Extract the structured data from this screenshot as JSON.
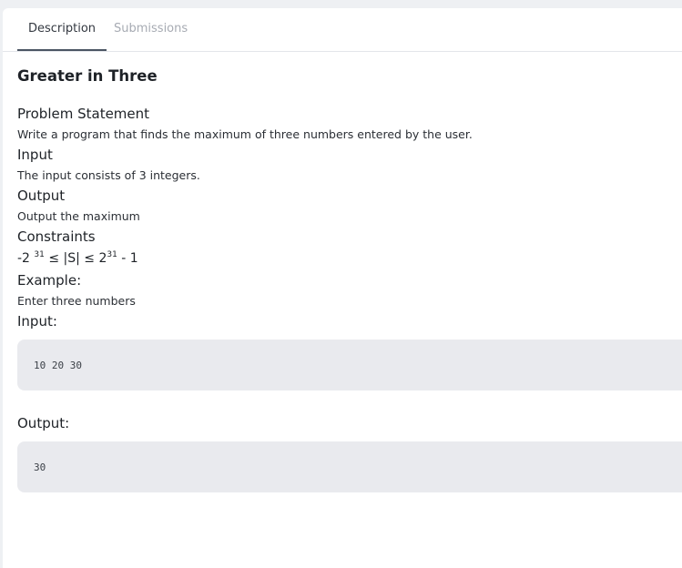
{
  "tabs": [
    {
      "label": "Description",
      "active": true
    },
    {
      "label": "Submissions",
      "active": false
    }
  ],
  "problem": {
    "title": "Greater in Three",
    "statement_heading": "Problem Statement",
    "statement_text": "Write a program that finds the maximum of three numbers entered by the user.",
    "input_heading": "Input",
    "input_text": "The input consists of 3 integers.",
    "output_heading": "Output",
    "output_text": "Output the maximum",
    "constraints_heading": "Constraints",
    "constraint": {
      "prefix": "-2 ",
      "exp1": "31",
      "middle": " ≤ |S| ≤ 2",
      "exp2": "31",
      "suffix": " - 1"
    },
    "example_heading": "Example:",
    "example_text": "Enter three numbers",
    "example_input_label": "Input:",
    "example_input_value": "10 20 30",
    "example_output_label": "Output:",
    "example_output_value": "30"
  },
  "colors": {
    "page_background": "#eef0f3",
    "panel_background": "#ffffff",
    "code_background": "#e9eaee",
    "active_tab_underline": "#4b5563",
    "inactive_tab_text": "#a7abb3"
  }
}
